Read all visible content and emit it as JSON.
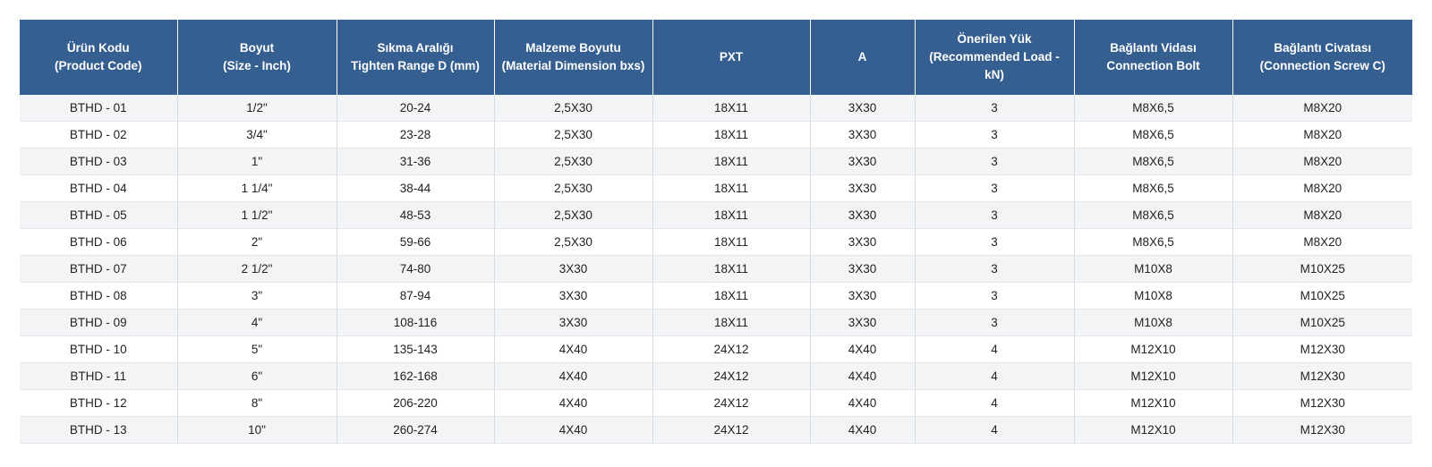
{
  "table": {
    "headers": [
      [
        "Ürün Kodu",
        "(Product Code)"
      ],
      [
        "Boyut",
        "(Size - Inch)"
      ],
      [
        "Sıkma Aralığı",
        "Tighten Range D (mm)"
      ],
      [
        "Malzeme Boyutu",
        "(Material Dimension bxs)"
      ],
      [
        "PXT"
      ],
      [
        "A"
      ],
      [
        "Önerilen Yük",
        "(Recommended Load -",
        "kN)"
      ],
      [
        "Bağlantı Vidası",
        "Connection Bolt"
      ],
      [
        "Bağlantı Civatası",
        "(Connection Screw C)"
      ]
    ],
    "rows": [
      [
        "BTHD - 01",
        "1/2\"",
        "20-24",
        "2,5X30",
        "18X11",
        "3X30",
        "3",
        "M8X6,5",
        "M8X20"
      ],
      [
        "BTHD - 02",
        "3/4\"",
        "23-28",
        "2,5X30",
        "18X11",
        "3X30",
        "3",
        "M8X6,5",
        "M8X20"
      ],
      [
        "BTHD - 03",
        "1\"",
        "31-36",
        "2,5X30",
        "18X11",
        "3X30",
        "3",
        "M8X6,5",
        "M8X20"
      ],
      [
        "BTHD - 04",
        "1 1/4\"",
        "38-44",
        "2,5X30",
        "18X11",
        "3X30",
        "3",
        "M8X6,5",
        "M8X20"
      ],
      [
        "BTHD - 05",
        "1 1/2\"",
        "48-53",
        "2,5X30",
        "18X11",
        "3X30",
        "3",
        "M8X6,5",
        "M8X20"
      ],
      [
        "BTHD - 06",
        "2\"",
        "59-66",
        "2,5X30",
        "18X11",
        "3X30",
        "3",
        "M8X6,5",
        "M8X20"
      ],
      [
        "BTHD - 07",
        "2 1/2\"",
        "74-80",
        "3X30",
        "18X11",
        "3X30",
        "3",
        "M10X8",
        "M10X25"
      ],
      [
        "BTHD - 08",
        "3\"",
        "87-94",
        "3X30",
        "18X11",
        "3X30",
        "3",
        "M10X8",
        "M10X25"
      ],
      [
        "BTHD - 09",
        "4\"",
        "108-116",
        "3X30",
        "18X11",
        "3X30",
        "3",
        "M10X8",
        "M10X25"
      ],
      [
        "BTHD - 10",
        "5\"",
        "135-143",
        "4X40",
        "24X12",
        "4X40",
        "4",
        "M12X10",
        "M12X30"
      ],
      [
        "BTHD - 11",
        "6\"",
        "162-168",
        "4X40",
        "24X12",
        "4X40",
        "4",
        "M12X10",
        "M12X30"
      ],
      [
        "BTHD - 12",
        "8\"",
        "206-220",
        "4X40",
        "24X12",
        "4X40",
        "4",
        "M12X10",
        "M12X30"
      ],
      [
        "BTHD - 13",
        "10\"",
        "260-274",
        "4X40",
        "24X12",
        "4X40",
        "4",
        "M12X10",
        "M12X30"
      ]
    ]
  },
  "colors": {
    "header_bg": "#355f91",
    "header_text": "#ffffff",
    "row_stripe": "#f3f4f6",
    "row_plain": "#ffffff"
  }
}
